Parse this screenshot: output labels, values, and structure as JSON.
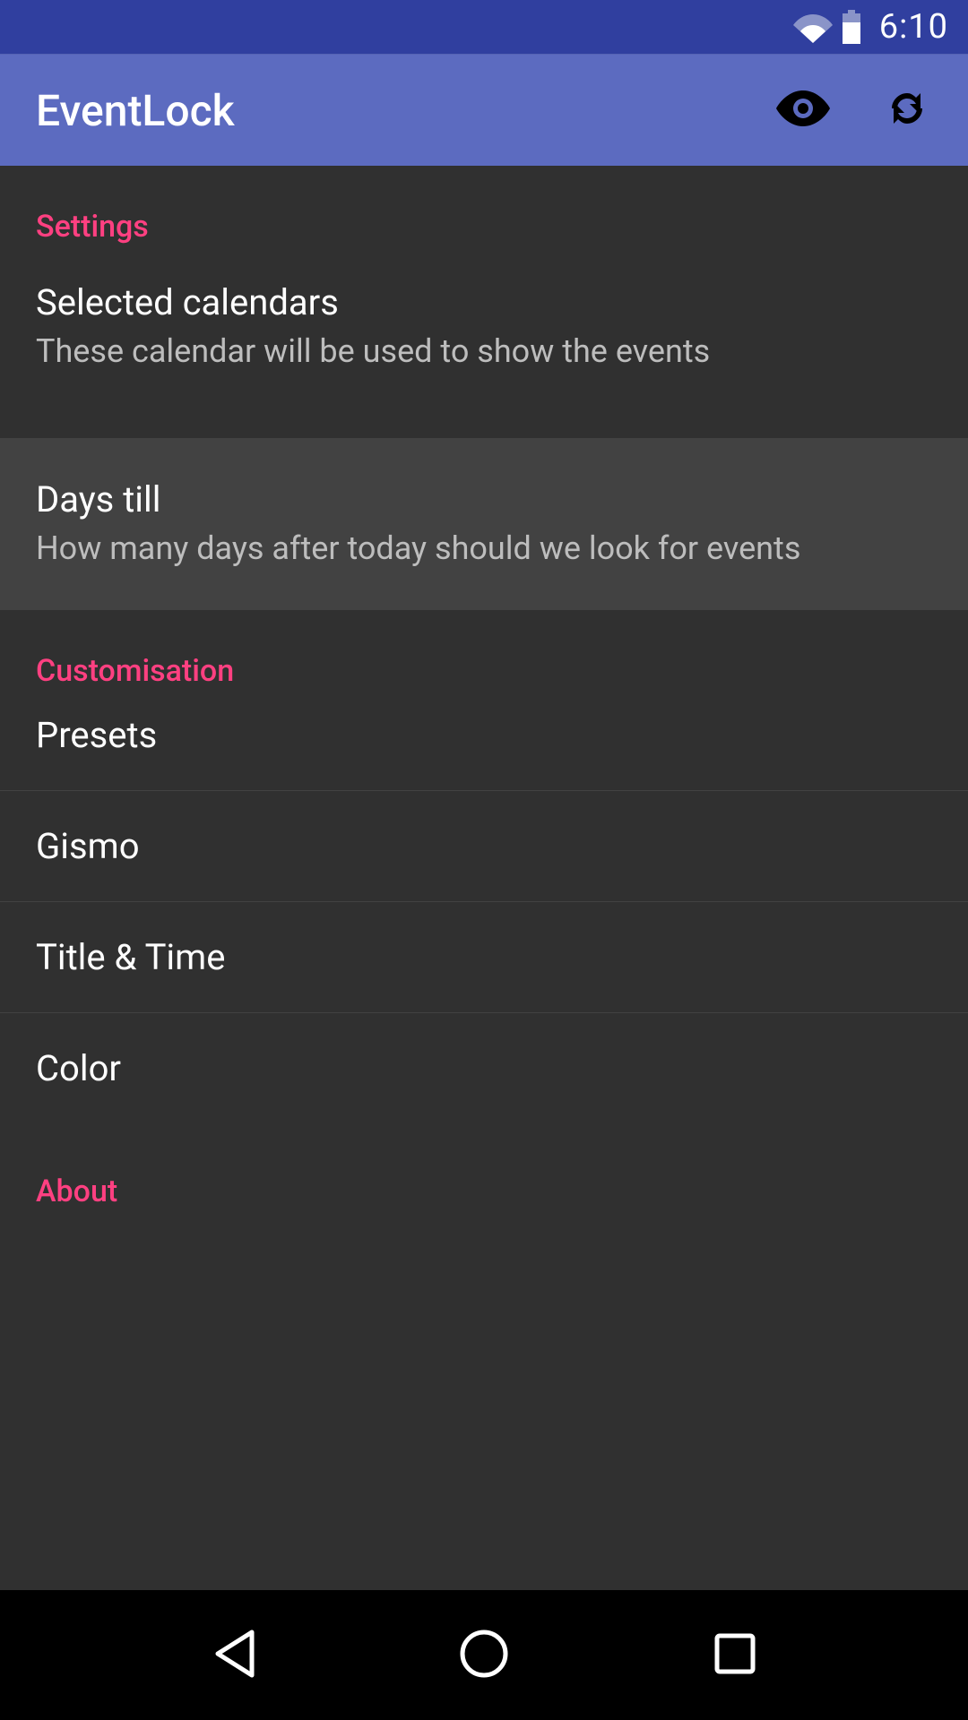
{
  "status": {
    "time": "6:10"
  },
  "appbar": {
    "title": "EventLock"
  },
  "sections": {
    "settings": {
      "header": "Settings",
      "items": [
        {
          "primary": "Selected calendars",
          "secondary": "These calendar will be used to show the events"
        },
        {
          "primary": "Days till",
          "secondary": "How many days after today should we look for events"
        }
      ]
    },
    "customisation": {
      "header": "Customisation",
      "items": [
        {
          "primary": "Presets"
        },
        {
          "primary": "Gismo"
        },
        {
          "primary": "Title & Time"
        },
        {
          "primary": "Color"
        }
      ]
    },
    "about": {
      "header": "About"
    }
  }
}
